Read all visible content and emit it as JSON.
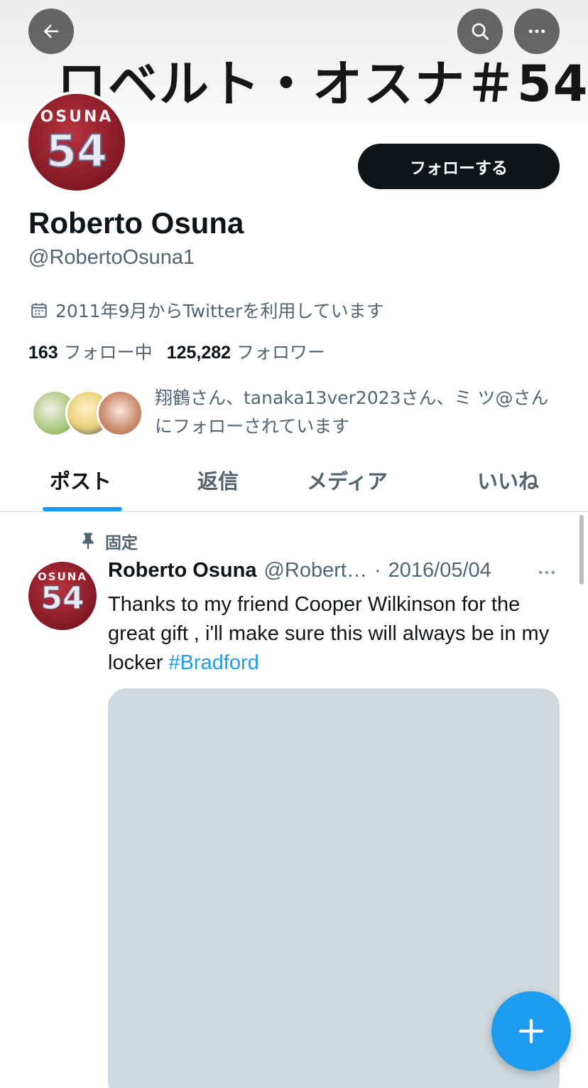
{
  "banner": {
    "text": "ロベルト・オスナ＃54"
  },
  "header": {
    "back_icon": "arrow-left-icon",
    "search_icon": "search-icon",
    "more_icon": "more-horizontal-icon"
  },
  "avatar": {
    "jersey_name": "OSUNA",
    "jersey_number": "54"
  },
  "follow_button": {
    "label": "フォローする"
  },
  "profile": {
    "display_name": "Roberto Osuna",
    "handle": "@RobertoOsuna1",
    "joined": "2011年9月からTwitterを利用しています",
    "following_count": "163",
    "following_label": "フォロー中",
    "followers_count": "125,282",
    "followers_label": "フォロワー"
  },
  "followed_by": {
    "text": "翔鶴さん、tanaka13ver2023さん、ミ ツ@さんにフォローされています"
  },
  "tabs": [
    {
      "label": "ポスト",
      "active": true
    },
    {
      "label": "返信",
      "active": false
    },
    {
      "label": "メディア",
      "active": false
    },
    {
      "label": "いいね",
      "active": false
    }
  ],
  "post": {
    "pinned_label": "固定",
    "author_name": "Roberto Osuna",
    "author_handle": "@Robert…",
    "separator": "·",
    "date": "2016/05/04",
    "text": "Thanks to my friend Cooper Wilkinson for the great gift , i'll make sure this will always be in my locker ",
    "hashtag": "#Bradford"
  },
  "colors": {
    "accent": "#1d9bf0",
    "text_primary": "#0f1419",
    "text_secondary": "#536471",
    "follow_button_bg": "#0f1419",
    "media_placeholder": "#cfd9de"
  }
}
